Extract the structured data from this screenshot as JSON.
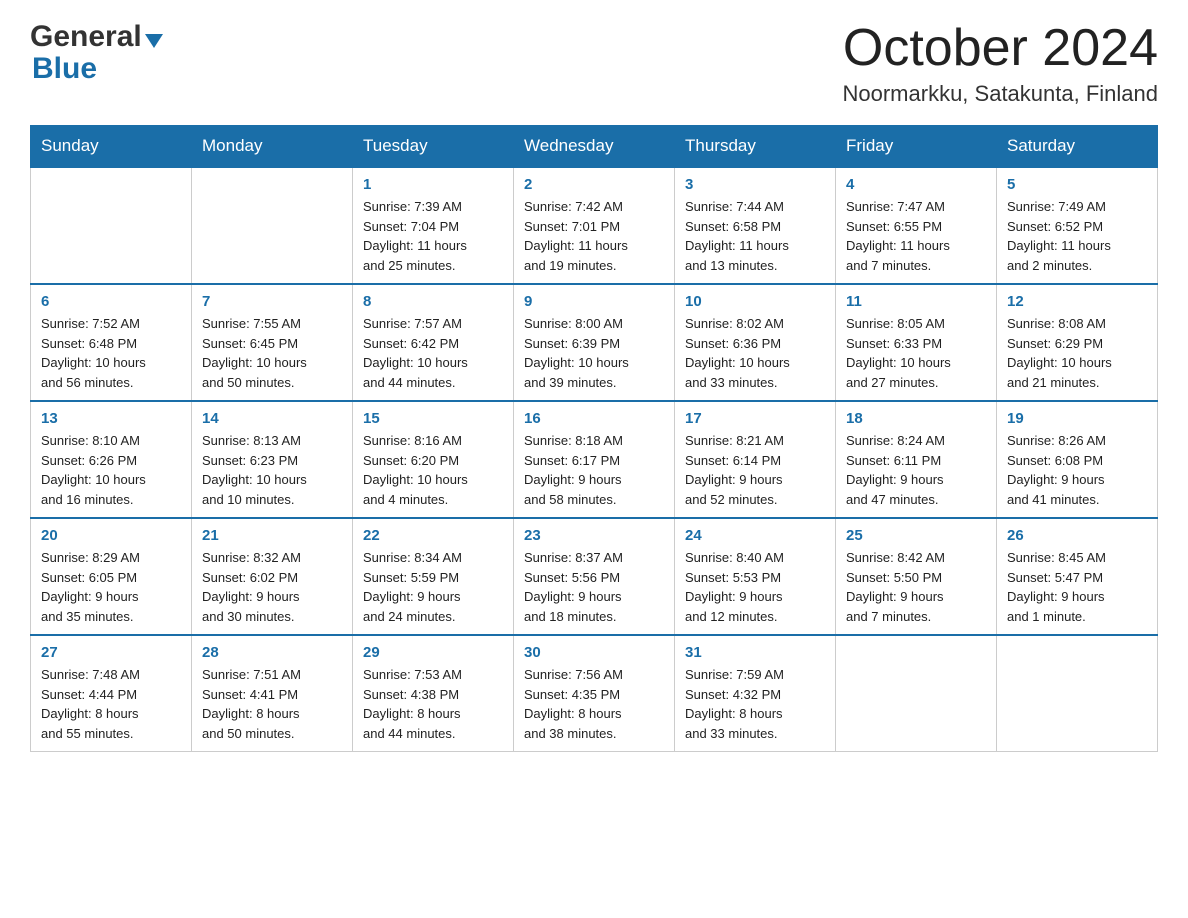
{
  "header": {
    "logo_general": "General",
    "logo_blue": "Blue",
    "month_title": "October 2024",
    "location": "Noormarkku, Satakunta, Finland"
  },
  "days_of_week": [
    "Sunday",
    "Monday",
    "Tuesday",
    "Wednesday",
    "Thursday",
    "Friday",
    "Saturday"
  ],
  "weeks": [
    [
      {
        "day": "",
        "info": ""
      },
      {
        "day": "",
        "info": ""
      },
      {
        "day": "1",
        "info": "Sunrise: 7:39 AM\nSunset: 7:04 PM\nDaylight: 11 hours\nand 25 minutes."
      },
      {
        "day": "2",
        "info": "Sunrise: 7:42 AM\nSunset: 7:01 PM\nDaylight: 11 hours\nand 19 minutes."
      },
      {
        "day": "3",
        "info": "Sunrise: 7:44 AM\nSunset: 6:58 PM\nDaylight: 11 hours\nand 13 minutes."
      },
      {
        "day": "4",
        "info": "Sunrise: 7:47 AM\nSunset: 6:55 PM\nDaylight: 11 hours\nand 7 minutes."
      },
      {
        "day": "5",
        "info": "Sunrise: 7:49 AM\nSunset: 6:52 PM\nDaylight: 11 hours\nand 2 minutes."
      }
    ],
    [
      {
        "day": "6",
        "info": "Sunrise: 7:52 AM\nSunset: 6:48 PM\nDaylight: 10 hours\nand 56 minutes."
      },
      {
        "day": "7",
        "info": "Sunrise: 7:55 AM\nSunset: 6:45 PM\nDaylight: 10 hours\nand 50 minutes."
      },
      {
        "day": "8",
        "info": "Sunrise: 7:57 AM\nSunset: 6:42 PM\nDaylight: 10 hours\nand 44 minutes."
      },
      {
        "day": "9",
        "info": "Sunrise: 8:00 AM\nSunset: 6:39 PM\nDaylight: 10 hours\nand 39 minutes."
      },
      {
        "day": "10",
        "info": "Sunrise: 8:02 AM\nSunset: 6:36 PM\nDaylight: 10 hours\nand 33 minutes."
      },
      {
        "day": "11",
        "info": "Sunrise: 8:05 AM\nSunset: 6:33 PM\nDaylight: 10 hours\nand 27 minutes."
      },
      {
        "day": "12",
        "info": "Sunrise: 8:08 AM\nSunset: 6:29 PM\nDaylight: 10 hours\nand 21 minutes."
      }
    ],
    [
      {
        "day": "13",
        "info": "Sunrise: 8:10 AM\nSunset: 6:26 PM\nDaylight: 10 hours\nand 16 minutes."
      },
      {
        "day": "14",
        "info": "Sunrise: 8:13 AM\nSunset: 6:23 PM\nDaylight: 10 hours\nand 10 minutes."
      },
      {
        "day": "15",
        "info": "Sunrise: 8:16 AM\nSunset: 6:20 PM\nDaylight: 10 hours\nand 4 minutes."
      },
      {
        "day": "16",
        "info": "Sunrise: 8:18 AM\nSunset: 6:17 PM\nDaylight: 9 hours\nand 58 minutes."
      },
      {
        "day": "17",
        "info": "Sunrise: 8:21 AM\nSunset: 6:14 PM\nDaylight: 9 hours\nand 52 minutes."
      },
      {
        "day": "18",
        "info": "Sunrise: 8:24 AM\nSunset: 6:11 PM\nDaylight: 9 hours\nand 47 minutes."
      },
      {
        "day": "19",
        "info": "Sunrise: 8:26 AM\nSunset: 6:08 PM\nDaylight: 9 hours\nand 41 minutes."
      }
    ],
    [
      {
        "day": "20",
        "info": "Sunrise: 8:29 AM\nSunset: 6:05 PM\nDaylight: 9 hours\nand 35 minutes."
      },
      {
        "day": "21",
        "info": "Sunrise: 8:32 AM\nSunset: 6:02 PM\nDaylight: 9 hours\nand 30 minutes."
      },
      {
        "day": "22",
        "info": "Sunrise: 8:34 AM\nSunset: 5:59 PM\nDaylight: 9 hours\nand 24 minutes."
      },
      {
        "day": "23",
        "info": "Sunrise: 8:37 AM\nSunset: 5:56 PM\nDaylight: 9 hours\nand 18 minutes."
      },
      {
        "day": "24",
        "info": "Sunrise: 8:40 AM\nSunset: 5:53 PM\nDaylight: 9 hours\nand 12 minutes."
      },
      {
        "day": "25",
        "info": "Sunrise: 8:42 AM\nSunset: 5:50 PM\nDaylight: 9 hours\nand 7 minutes."
      },
      {
        "day": "26",
        "info": "Sunrise: 8:45 AM\nSunset: 5:47 PM\nDaylight: 9 hours\nand 1 minute."
      }
    ],
    [
      {
        "day": "27",
        "info": "Sunrise: 7:48 AM\nSunset: 4:44 PM\nDaylight: 8 hours\nand 55 minutes."
      },
      {
        "day": "28",
        "info": "Sunrise: 7:51 AM\nSunset: 4:41 PM\nDaylight: 8 hours\nand 50 minutes."
      },
      {
        "day": "29",
        "info": "Sunrise: 7:53 AM\nSunset: 4:38 PM\nDaylight: 8 hours\nand 44 minutes."
      },
      {
        "day": "30",
        "info": "Sunrise: 7:56 AM\nSunset: 4:35 PM\nDaylight: 8 hours\nand 38 minutes."
      },
      {
        "day": "31",
        "info": "Sunrise: 7:59 AM\nSunset: 4:32 PM\nDaylight: 8 hours\nand 33 minutes."
      },
      {
        "day": "",
        "info": ""
      },
      {
        "day": "",
        "info": ""
      }
    ]
  ]
}
